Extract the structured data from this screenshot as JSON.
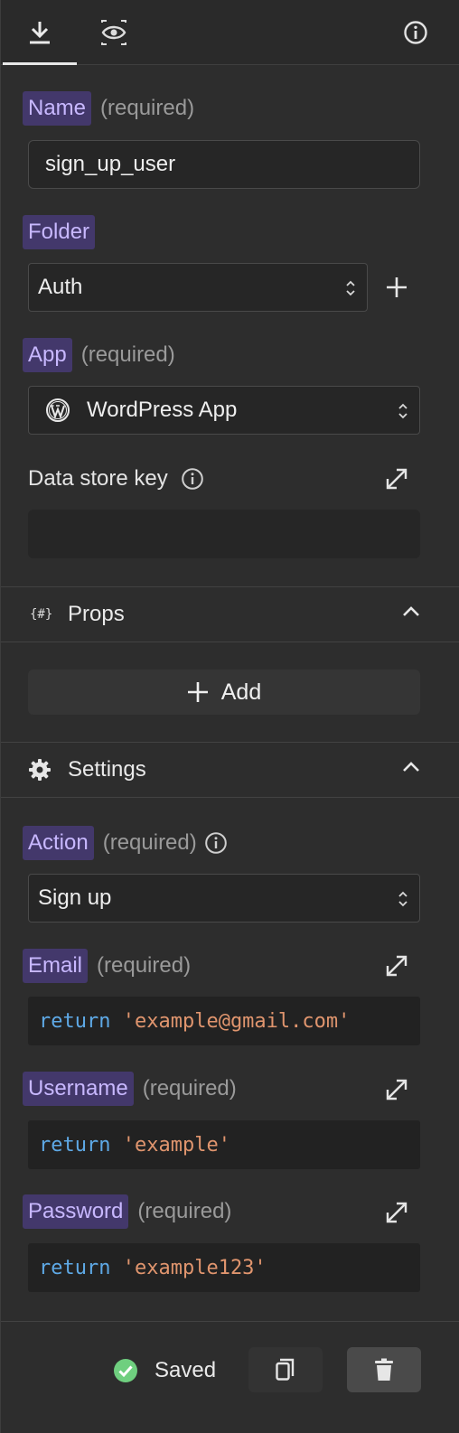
{
  "tabs": [
    {
      "icon": "download-icon"
    },
    {
      "icon": "eye-icon"
    },
    {
      "icon": "info-icon"
    }
  ],
  "name": {
    "label": "Name",
    "required": "(required)",
    "value": "sign_up_user"
  },
  "folder": {
    "label": "Folder",
    "value": "Auth"
  },
  "app": {
    "label": "App",
    "required": "(required)",
    "value": "WordPress App",
    "icon": "wordpress-icon"
  },
  "data_store_key": {
    "label": "Data store key",
    "value": ""
  },
  "props": {
    "title": "Props",
    "icon_text": "{#}",
    "add_label": "Add"
  },
  "settings": {
    "title": "Settings",
    "action": {
      "label": "Action",
      "required": "(required)",
      "value": "Sign up"
    },
    "email": {
      "label": "Email",
      "required": "(required)",
      "code_kw": "return",
      "code_str": "'example@gmail.com'"
    },
    "username": {
      "label": "Username",
      "required": "(required)",
      "code_kw": "return",
      "code_str": "'example'"
    },
    "password": {
      "label": "Password",
      "required": "(required)",
      "code_kw": "return",
      "code_str": "'example123'"
    }
  },
  "footer": {
    "saved_label": "Saved",
    "status_color": "#6fcf7f"
  },
  "colors": {
    "accent_bg": "#43386b",
    "accent_text": "#c8b8ff",
    "keyword": "#5ea9e6",
    "string": "#e0956e"
  }
}
